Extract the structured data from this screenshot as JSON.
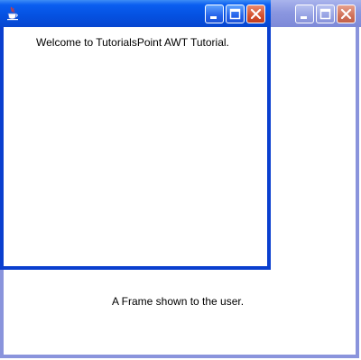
{
  "frame_window": {
    "message": "A Frame shown to the user."
  },
  "dialog_window": {
    "message": "Welcome to TutorialsPoint AWT Tutorial.",
    "icon": "java-cup-icon"
  },
  "title_buttons": [
    "minimize-icon",
    "maximize-icon",
    "close-icon"
  ],
  "colors": {
    "active_titlebar": "#0552e2",
    "inactive_titlebar": "#8b97e0",
    "close_button": "#d3502e"
  }
}
